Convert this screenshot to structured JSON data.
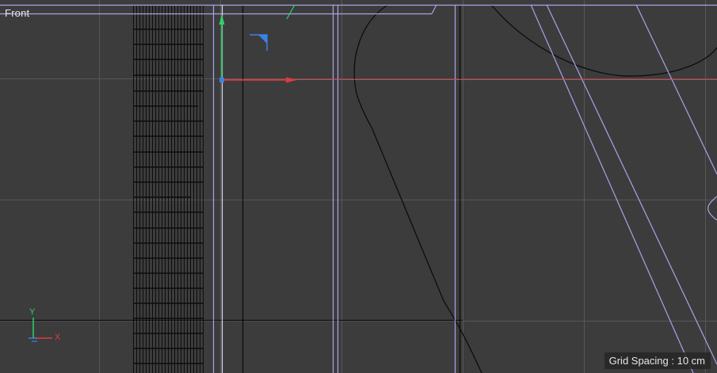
{
  "viewport": {
    "view_name": "Front",
    "grid_spacing_label": "Grid Spacing : 10 cm"
  },
  "axis_indicator": {
    "y_label": "Y",
    "x_label": "X"
  },
  "colors": {
    "background": "#3c3c3c",
    "grid_line": "#575757",
    "wire_black": "#0d0d0d",
    "wire_violet": "#a9a2ea",
    "wire_white": "#dcdcf5",
    "axis_x": "#e23b3b",
    "axis_y": "#2fd06a",
    "axis_z": "#3a82e6",
    "text": "#e6e6e6"
  },
  "icons": {
    "object_axis": "move-gizmo-icon",
    "camera_corner": "view-corner-icon",
    "world_axis": "world-axis-icon"
  }
}
